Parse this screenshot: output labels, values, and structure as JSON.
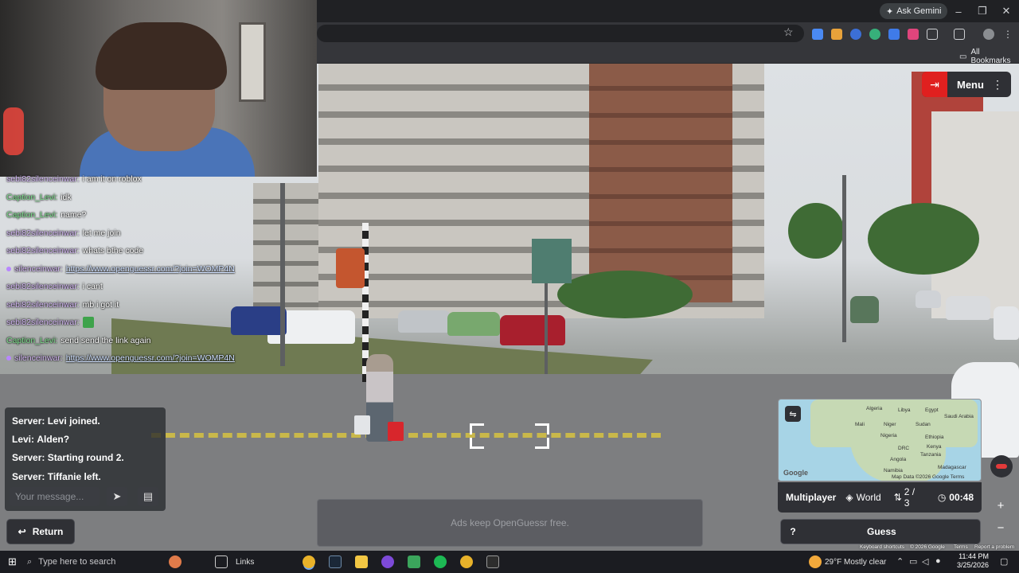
{
  "browser": {
    "ask_gemini": "Ask Gemini",
    "all_bookmarks": "All Bookmarks",
    "min_icon": "–",
    "max_icon": "❐",
    "close_icon": "✕"
  },
  "twitch_chat": {
    "lines": [
      {
        "user": "sebi82silenceinwar:",
        "text": "i am it on roblox"
      },
      {
        "user": "Caption_Levi:",
        "text": "idk"
      },
      {
        "user": "Caption_Levi:",
        "text": "name?"
      },
      {
        "user": "sebi82silenceinwar:",
        "text": "let me join"
      },
      {
        "user": "sebi82silenceinwar:",
        "text": "whats bthe code"
      },
      {
        "user": "silenceinwar:",
        "text": "https://www.openguessr.com/?join=WOMP4N"
      },
      {
        "user": "sebi82silenceinwar:",
        "text": "i cant"
      },
      {
        "user": "sebi82silenceinwar:",
        "text": "mb i got it"
      },
      {
        "user": "sebi82silenceinwar:",
        "text": ""
      },
      {
        "user": "Caption_Levi:",
        "text": "send send the link again"
      },
      {
        "user": "silenceinwar:",
        "text": "https://www.openguessr.com/?join=WOMP4N"
      }
    ]
  },
  "game": {
    "menu_label": "Menu",
    "chat_messages": [
      {
        "prefix": "Server:",
        "text": "Levi joined."
      },
      {
        "prefix": "Levi:",
        "text": "Alden?"
      },
      {
        "prefix": "Server:",
        "text": "Starting round 2."
      },
      {
        "prefix": "Server:",
        "text": "Tiffanie left."
      }
    ],
    "message_placeholder": "Your message...",
    "return_label": "Return",
    "ad_text": "Ads keep OpenGuessr free.",
    "mode": "Multiplayer",
    "map_name": "World",
    "round": "2 / 3",
    "timer": "00:48",
    "help_label": "?",
    "guess_label": "Guess",
    "map_attrib": "Map Data ©2026 Google  Terms",
    "google_label": "Google",
    "map_labels": [
      "Algeria",
      "Libya",
      "Egypt",
      "Saudi Arabia",
      "Mali",
      "Niger",
      "Sudan",
      "Nigeria",
      "Ethiopia",
      "DRC",
      "Kenya",
      "Tanzania",
      "Angola",
      "Madagascar",
      "Namibia"
    ],
    "keyboard_shortcuts": "Keyboard shortcuts",
    "copyright": "© 2026 Google",
    "terms": "Terms",
    "report": "Report a problem"
  },
  "taskbar": {
    "search_placeholder": "Type here to search",
    "links_label": "Links",
    "weather": "29°F  Mostly clear",
    "time": "11:44 PM",
    "date": "3/25/2026"
  },
  "colors": {
    "exit_red": "#e0201f",
    "panel": "#2f3035",
    "chat_purple": "#d4b7f5",
    "chat_green": "#7ee08d"
  }
}
